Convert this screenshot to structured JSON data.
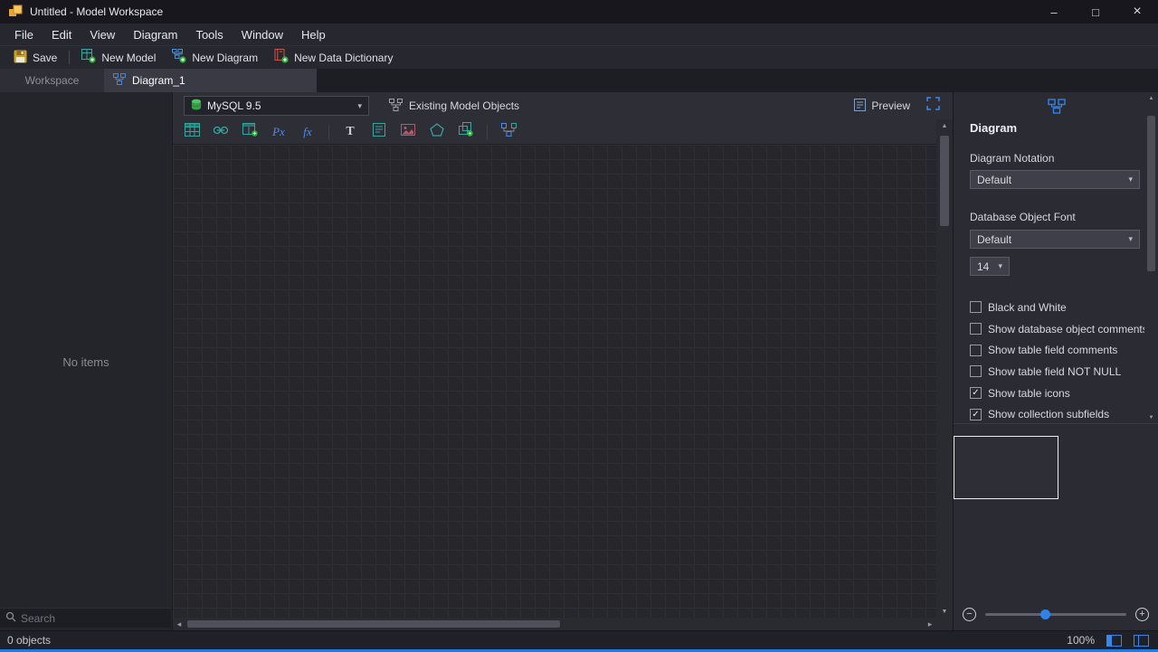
{
  "glyphs": {
    "minimize": "–",
    "maximize": "□",
    "close": "×",
    "chevron_down": "▾",
    "scroll_up": "▲",
    "scroll_down": "▼",
    "scroll_left": "◂",
    "scroll_right": "▸",
    "minus": "−",
    "plus": "+",
    "check": "✓"
  },
  "titlebar": {
    "title": "Untitled - Model Workspace"
  },
  "menubar": {
    "items": [
      "File",
      "Edit",
      "View",
      "Diagram",
      "Tools",
      "Window",
      "Help"
    ]
  },
  "toolbar": {
    "save": "Save",
    "new_model": "New Model",
    "new_diagram": "New Diagram",
    "new_data_dictionary": "New Data Dictionary"
  },
  "tabs": {
    "workspace": "Workspace",
    "diagram": "Diagram_1"
  },
  "left_panel": {
    "empty_text": "No items",
    "search_placeholder": "Search"
  },
  "canvas": {
    "database_select": "MySQL 9.5",
    "existing_model_objects": "Existing Model Objects",
    "preview": "Preview",
    "tools": {
      "px": "Px",
      "fx": "fx",
      "text": "T"
    }
  },
  "right_panel": {
    "title": "Diagram",
    "notation_label": "Diagram Notation",
    "notation_value": "Default",
    "font_label": "Database Object Font",
    "font_value": "Default",
    "font_size": "14",
    "checkboxes": [
      {
        "label": "Black and White",
        "checked": false
      },
      {
        "label": "Show database object comments",
        "checked": false
      },
      {
        "label": "Show table field comments",
        "checked": false
      },
      {
        "label": "Show table field NOT NULL",
        "checked": false
      },
      {
        "label": "Show table icons",
        "checked": true
      },
      {
        "label": "Show collection subfields",
        "checked": true
      }
    ]
  },
  "statusbar": {
    "objects": "0 objects",
    "zoom": "100%"
  }
}
